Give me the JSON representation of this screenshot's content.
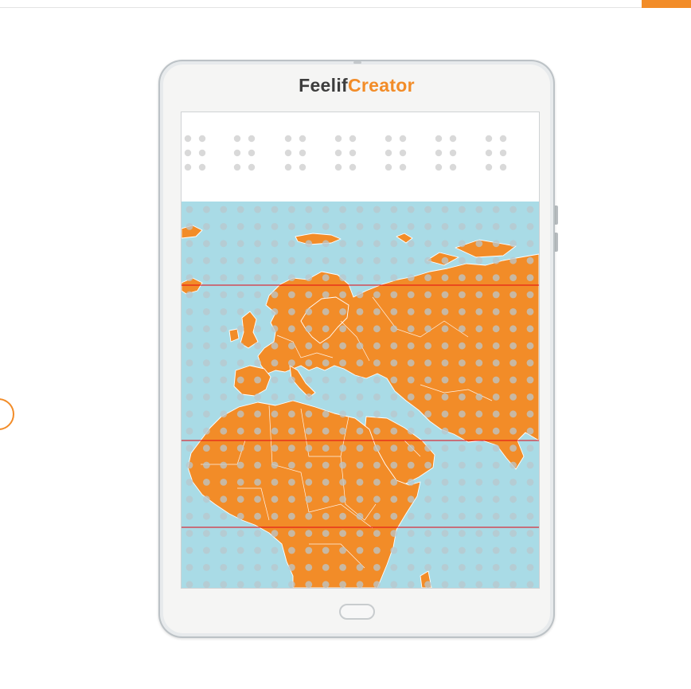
{
  "app": {
    "brand_part1": "Feelif",
    "brand_part2": "Creator"
  },
  "colors": {
    "accent": "#f28c28",
    "ocean": "#a9dbe6",
    "land": "#f28c28",
    "grid_line": "#e30613",
    "braille_dot": "#d9d9d9",
    "map_dot": "#b9c7cc"
  },
  "icons": [
    "home-button-icon"
  ]
}
